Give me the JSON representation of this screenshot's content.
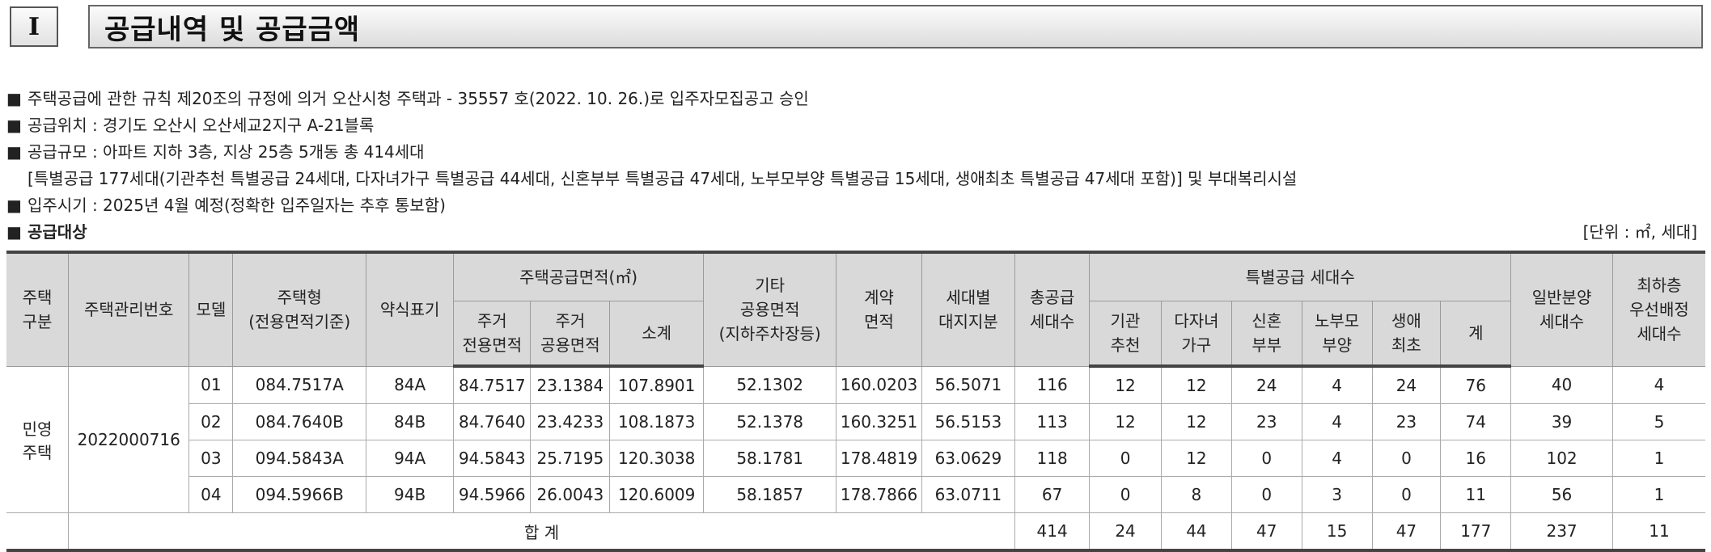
{
  "section": {
    "number": "I",
    "title": "공급내역 및 공급금액"
  },
  "notes": [
    "주택공급에 관한 규칙 제20조의 규정에 의거 오산시청 주택과 - 35557 호(2022. 10. 26.)로 입주자모집공고 승인",
    "공급위치 : 경기도 오산시 오산세교2지구 A-21블록",
    "공급규모 : 아파트 지하 3층, 지상 25층 5개동 총 414세대",
    "[특별공급 177세대(기관추천 특별공급 24세대, 다자녀가구 특별공급 44세대, 신혼부부 특별공급 47세대, 노부모부양 특별공급 15세대, 생애최초 특별공급 47세대 포함)] 및 부대복리시설",
    "입주시기 : 2025년 4월 예정(정확한 입주일자는 추후 통보함)"
  ],
  "bullet": "■",
  "target_label": "공급대상",
  "unit_label": "[단위 : ㎡, 세대]",
  "table": {
    "headers": {
      "housing_type_1": "주택",
      "housing_type_2": "구분",
      "mgmt_no": "주택관리번호",
      "model": "모델",
      "unit_type_1": "주택형",
      "unit_type_2": "(전용면적기준)",
      "short_name": "약식표기",
      "supply_area": "주택공급면적(㎡)",
      "exclusive_1": "주거",
      "exclusive_2": "전용면적",
      "common_1": "주거",
      "common_2": "공용면적",
      "subtotal": "소계",
      "other_common_1": "기타",
      "other_common_2": "공용면적",
      "other_common_3": "(지하주차장등)",
      "contract_1": "계약",
      "contract_2": "면적",
      "land_1": "세대별",
      "land_2": "대지지분",
      "total_units_1": "총공급",
      "total_units_2": "세대수",
      "special": "특별공급 세대수",
      "agency_1": "기관",
      "agency_2": "추천",
      "multichild_1": "다자녀",
      "multichild_2": "가구",
      "newlywed_1": "신혼",
      "newlywed_2": "부부",
      "elderly_1": "노부모",
      "elderly_2": "부양",
      "firsttime_1": "생애",
      "firsttime_2": "최초",
      "special_sum": "계",
      "general_1": "일반분양",
      "general_2": "세대수",
      "lowest_1": "최하층",
      "lowest_2": "우선배정",
      "lowest_3": "세대수"
    },
    "group_label_1": "민영",
    "group_label_2": "주택",
    "mgmt_no_value": "2022000716",
    "rows": [
      {
        "model": "01",
        "type": "084.7517A",
        "short": "84A",
        "exclusive": "84.7517",
        "common": "23.1384",
        "subtotal": "107.8901",
        "other": "52.1302",
        "contract": "160.0203",
        "land": "56.5071",
        "total": "116",
        "agency": "12",
        "multi": "12",
        "newly": "24",
        "elder": "4",
        "first": "24",
        "sp_sum": "76",
        "general": "40",
        "lowest": "4"
      },
      {
        "model": "02",
        "type": "084.7640B",
        "short": "84B",
        "exclusive": "84.7640",
        "common": "23.4233",
        "subtotal": "108.1873",
        "other": "52.1378",
        "contract": "160.3251",
        "land": "56.5153",
        "total": "113",
        "agency": "12",
        "multi": "12",
        "newly": "23",
        "elder": "4",
        "first": "23",
        "sp_sum": "74",
        "general": "39",
        "lowest": "5"
      },
      {
        "model": "03",
        "type": "094.5843A",
        "short": "94A",
        "exclusive": "94.5843",
        "common": "25.7195",
        "subtotal": "120.3038",
        "other": "58.1781",
        "contract": "178.4819",
        "land": "63.0629",
        "total": "118",
        "agency": "0",
        "multi": "12",
        "newly": "0",
        "elder": "4",
        "first": "0",
        "sp_sum": "16",
        "general": "102",
        "lowest": "1"
      },
      {
        "model": "04",
        "type": "094.5966B",
        "short": "94B",
        "exclusive": "94.5966",
        "common": "26.0043",
        "subtotal": "120.6009",
        "other": "58.1857",
        "contract": "178.7866",
        "land": "63.0711",
        "total": "67",
        "agency": "0",
        "multi": "8",
        "newly": "0",
        "elder": "3",
        "first": "0",
        "sp_sum": "11",
        "general": "56",
        "lowest": "1"
      }
    ],
    "total_row": {
      "label": "합  계",
      "total": "414",
      "agency": "24",
      "multi": "44",
      "newly": "47",
      "elder": "15",
      "first": "47",
      "sp_sum": "177",
      "general": "237",
      "lowest": "11"
    }
  }
}
